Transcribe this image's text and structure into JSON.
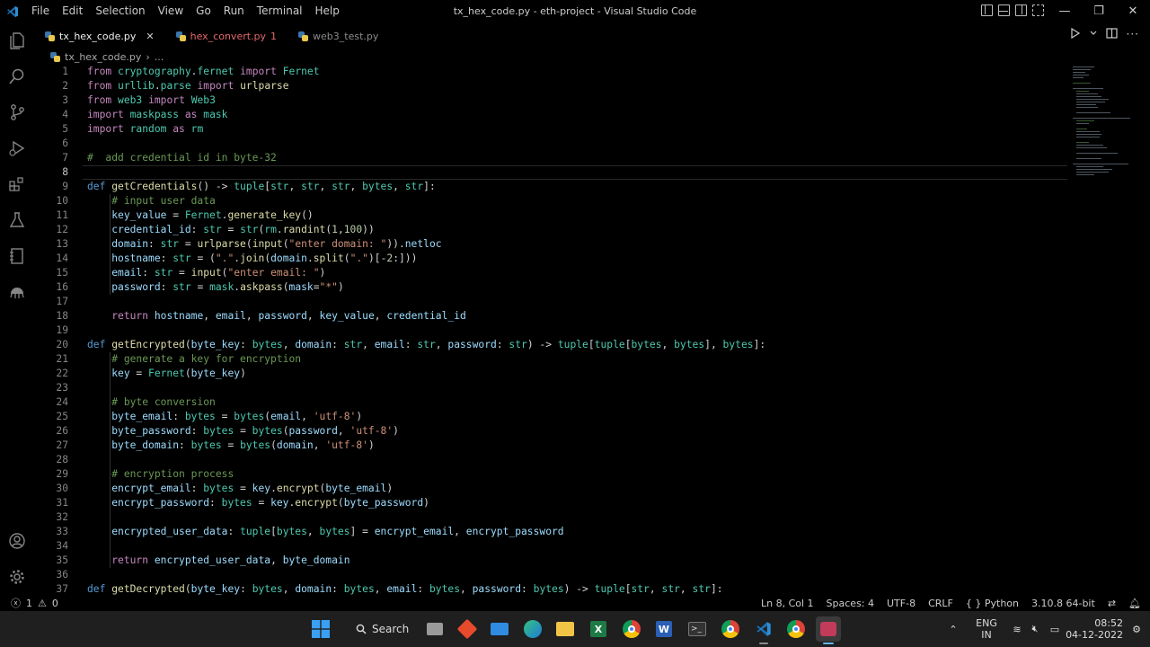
{
  "window": {
    "title": "tx_hex_code.py - eth-project - Visual Studio Code"
  },
  "menu": [
    "File",
    "Edit",
    "Selection",
    "View",
    "Go",
    "Run",
    "Terminal",
    "Help"
  ],
  "tabs": [
    {
      "label": "tx_hex_code.py",
      "close": "✕"
    },
    {
      "label": "hex_convert.py",
      "badge": "1"
    },
    {
      "label": "web3_test.py"
    }
  ],
  "breadcrumb": {
    "file": "tx_hex_code.py",
    "rest": "..."
  },
  "editor": {
    "line_numbers": [
      "1",
      "2",
      "3",
      "4",
      "5",
      "6",
      "7",
      "8",
      "9",
      "10",
      "11",
      "12",
      "13",
      "14",
      "15",
      "16",
      "17",
      "18",
      "19",
      "20",
      "21",
      "22",
      "23",
      "24",
      "25",
      "26",
      "27",
      "28",
      "29",
      "30",
      "31",
      "32",
      "33",
      "34",
      "35",
      "36",
      "37"
    ]
  },
  "status": {
    "problems": "1",
    "warnings": "0",
    "position": "Ln 8, Col 1",
    "spaces": "Spaces: 4",
    "encoding": "UTF-8",
    "eol": "CRLF",
    "language": "Python",
    "interpreter": "3.10.8 64-bit"
  },
  "taskbar": {
    "search_label": "Search",
    "lang_top": "ENG",
    "lang_bottom": "IN",
    "time": "08:52",
    "date": "04-12-2022"
  },
  "colors": {
    "keyword": "#c586c0",
    "builtin": "#569cd6",
    "function": "#dcdcaa",
    "type": "#4ec9b0",
    "string": "#ce9178",
    "comment": "#6a9955",
    "variable": "#9cdcfe"
  }
}
